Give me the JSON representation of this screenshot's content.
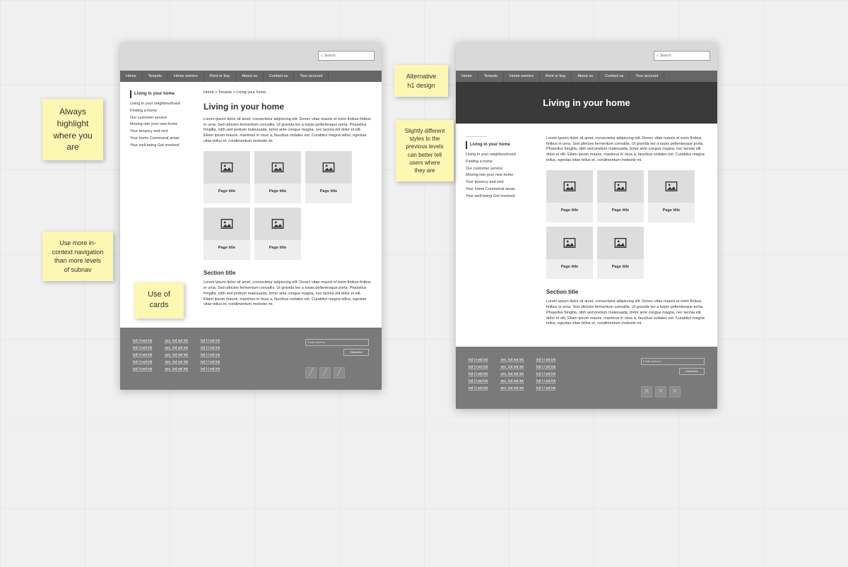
{
  "search_placeholder": "Search",
  "nav": [
    "Home",
    "Tenants",
    "Home owners",
    "Rent or buy",
    "About us",
    "Contact us",
    "Your account"
  ],
  "breadcrumbs": "Home > Tenants > Living your home",
  "sidebar": {
    "heading": "Living in your home",
    "items": [
      "Living in your neighbourhood",
      "Finding a home",
      "Our customer service",
      "Moving into your new home",
      "Your tenancy and rent",
      "Your home   Communal areas",
      "Your well-being   Get involved"
    ]
  },
  "page_title": "Living in your home",
  "lorem": "Lorem ipsum dolor sit amet, consectetur adipiscing elit. Donec vitae mauris et enim finibus finibus in urna. Sed ultricies fermentum convallis. Ut gravida leo a turpis pellentesque porta. Phasellus fringilla, nibh sed pretium malesuada, tortor ante congue magna, nec lacinia elit dolor et elit. Etiam ipsum mauris, maximus in risus a, faucibus sodales est. Curabitur magna tellus, egestas vitae tellus et, condimentum molestie mi.",
  "card_title": "Page title",
  "section_title": "Section title",
  "footer": {
    "col1": [
      "lxd l-l-wd ink",
      "lxd l-l-wd ink",
      "lxd l-l-wd ink",
      "lxd l-l-wd ink",
      "lxd l-l-wd ink"
    ],
    "col2": [
      "sec. lxd wd ink",
      "sec. lxd wd ink",
      "sec. lxd wd ink",
      "sec. lxd wd ink",
      "sec. lxd wd ink"
    ],
    "col3": [
      "lxd l-l wd ink",
      "lxd l-l wd ink",
      "lxd l-l wd ink",
      "lxd l-l wd ink",
      "lxd l-l wd ink"
    ],
    "email_placeholder": "Email address",
    "subscribe": "Subscribe"
  },
  "notes": {
    "n1": "Always highlight where you are",
    "n2": "Use more in-context navigation than more levels of subnav",
    "n3": "Use of cards",
    "n4": "Alternative h1 design",
    "n5": "Slightly different styles to the previous levels can better tell users where they are"
  }
}
